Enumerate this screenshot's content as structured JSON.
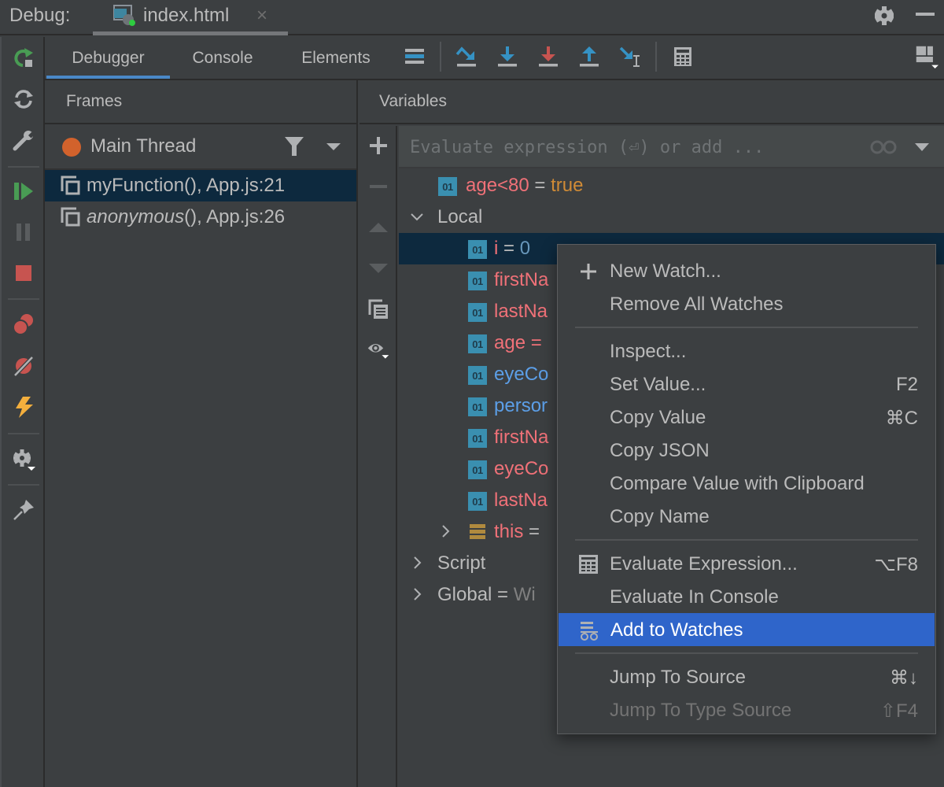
{
  "titlebar": {
    "label": "Debug:",
    "tab": {
      "label": "index.html",
      "close": "×",
      "icon": "html-debug-config-icon"
    },
    "gear_icon": "gear-icon",
    "minimize_icon": "minimize-icon"
  },
  "left_toolbar": [
    {
      "name": "rerun",
      "icon": "rerun-icon"
    },
    {
      "name": "reload",
      "icon": "reload-icon"
    },
    {
      "name": "settings-wrench",
      "icon": "wrench-icon"
    },
    {
      "name": "resume",
      "icon": "resume-icon"
    },
    {
      "name": "pause",
      "icon": "pause-icon"
    },
    {
      "name": "stop",
      "icon": "stop-icon"
    },
    {
      "name": "view-breakpoints",
      "icon": "breakpoints-icon"
    },
    {
      "name": "mute-breakpoints",
      "icon": "mute-breakpoints-icon"
    },
    {
      "name": "exceptions",
      "icon": "lightning-icon"
    },
    {
      "name": "debug-settings",
      "icon": "gear-dropdown-icon"
    },
    {
      "name": "pin-tab",
      "icon": "pin-icon"
    }
  ],
  "tabs": [
    {
      "label": "Debugger",
      "active": true
    },
    {
      "label": "Console",
      "active": false
    },
    {
      "label": "Elements",
      "active": false
    }
  ],
  "toolbar": [
    {
      "name": "show-execution-point",
      "icon": "show-execution-point-icon"
    },
    {
      "name": "step-over",
      "icon": "step-over-icon"
    },
    {
      "name": "step-into",
      "icon": "step-into-icon"
    },
    {
      "name": "force-step-into",
      "icon": "force-step-into-icon"
    },
    {
      "name": "step-out",
      "icon": "step-out-icon"
    },
    {
      "name": "run-to-cursor",
      "icon": "run-to-cursor-icon"
    },
    {
      "name": "evaluate-expression",
      "icon": "calculator-icon"
    },
    {
      "name": "layout-settings",
      "icon": "layout-icon"
    }
  ],
  "frames": {
    "header": "Frames",
    "thread": "Main Thread",
    "items": [
      {
        "func": "myFunction",
        "suffix": "(), App.js:21",
        "italic": false,
        "selected": true
      },
      {
        "func": "anonymous",
        "suffix": "(), App.js:26",
        "italic": true,
        "selected": false
      }
    ]
  },
  "variables": {
    "header": "Variables",
    "eval_placeholder": "Evaluate expression (⏎) or add ...",
    "badge": "01",
    "watch": {
      "name": "age<80",
      "eq": " = ",
      "value": "true"
    },
    "local": {
      "label": "Local"
    },
    "locals": [
      {
        "name": "i",
        "eq": " = ",
        "value": "0",
        "color": "red",
        "selected": true
      },
      {
        "name": "firstNa",
        "color": "red"
      },
      {
        "name": "lastNa",
        "color": "red"
      },
      {
        "name": "age =",
        "color": "red"
      },
      {
        "name": "eyeCo",
        "color": "blue"
      },
      {
        "name": "persor",
        "color": "blue"
      },
      {
        "name": "firstNa",
        "color": "red"
      },
      {
        "name": "eyeCo",
        "color": "red"
      },
      {
        "name": "lastNa",
        "color": "red"
      }
    ],
    "this_row": {
      "name": "this",
      "eq": " = "
    },
    "script": {
      "label": "Script"
    },
    "global": {
      "label": "Global",
      "eq": " = ",
      "value": "Wi"
    }
  },
  "context_menu": {
    "items": [
      {
        "label": "New Watch...",
        "shortcut": "",
        "icon": "plus-icon"
      },
      {
        "label": "Remove All Watches",
        "shortcut": ""
      },
      {
        "separator": true
      },
      {
        "label": "Inspect...",
        "shortcut": ""
      },
      {
        "label": "Set Value...",
        "shortcut": "F2"
      },
      {
        "label": "Copy Value",
        "shortcut": "⌘C"
      },
      {
        "label": "Copy JSON",
        "shortcut": ""
      },
      {
        "label": "Compare Value with Clipboard",
        "shortcut": ""
      },
      {
        "label": "Copy Name",
        "shortcut": ""
      },
      {
        "separator": true
      },
      {
        "label": "Evaluate Expression...",
        "shortcut": "⌥F8",
        "icon": "calculator-icon"
      },
      {
        "label": "Evaluate In Console",
        "shortcut": ""
      },
      {
        "label": "Add to Watches",
        "shortcut": "",
        "icon": "add-watch-icon",
        "highlighted": true
      },
      {
        "separator": true
      },
      {
        "label": "Jump To Source",
        "shortcut": "⌘↓"
      },
      {
        "label": "Jump To Type Source",
        "shortcut": "⇧F4",
        "disabled": true
      }
    ]
  },
  "colors": {
    "accent": "#4a88c7",
    "selection": "#0d293e",
    "menu_highlight": "#2f65ca",
    "thread_dot": "#d2622c"
  }
}
